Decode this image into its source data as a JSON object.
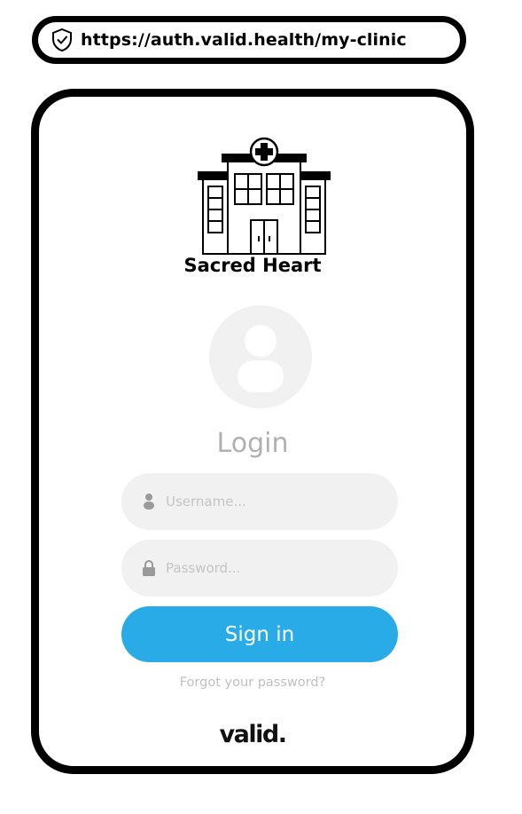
{
  "browser": {
    "url": "https://auth.valid.health/my-clinic",
    "security_icon": "shield-check-icon"
  },
  "clinic": {
    "name": "Sacred Heart",
    "logo_icon": "hospital-building-icon"
  },
  "login": {
    "avatar_icon": "user-avatar-icon",
    "title": "Login",
    "username": {
      "placeholder": "Username...",
      "value": "",
      "icon": "user-icon"
    },
    "password": {
      "placeholder": "Password...",
      "value": "",
      "icon": "lock-icon"
    },
    "signin_label": "Sign in",
    "forgot_label": "Forgot your password?"
  },
  "brand": {
    "name": "valid."
  },
  "colors": {
    "accent": "#29abe8",
    "field_bg": "#f1f1f1",
    "muted_text": "#b0b0b0"
  }
}
